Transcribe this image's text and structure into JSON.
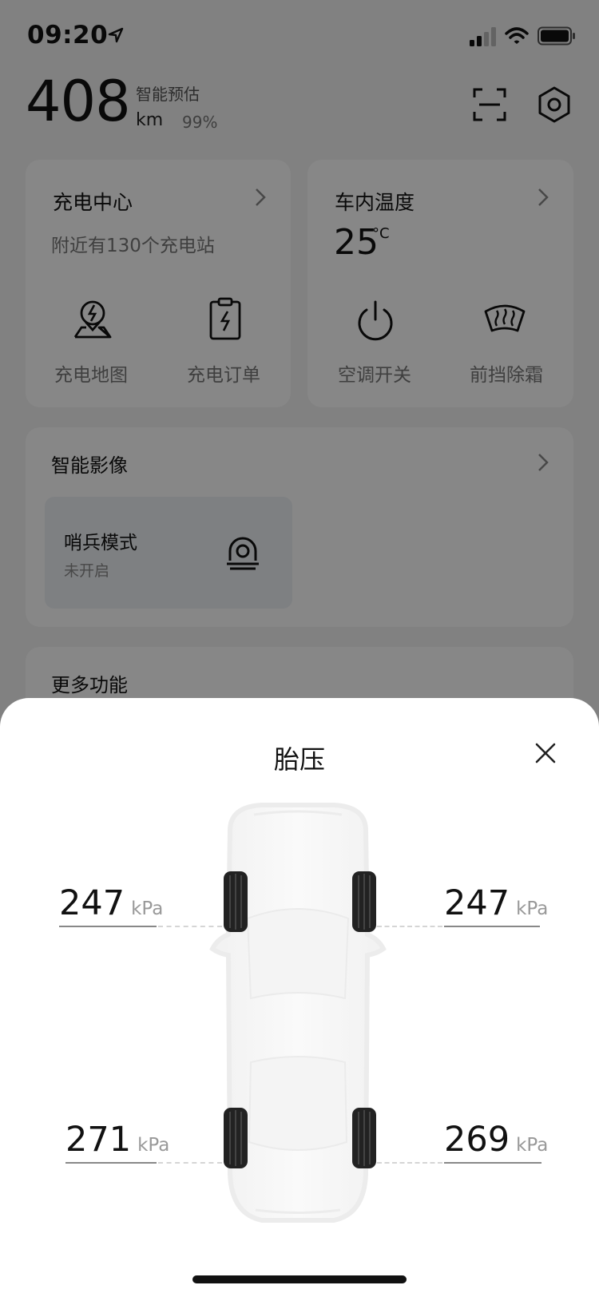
{
  "status_bar": {
    "time": "09:20"
  },
  "header": {
    "range_value": "408",
    "range_label": "智能预估",
    "range_unit": "km",
    "battery_percent": "99%"
  },
  "charging_card": {
    "title": "充电中心",
    "subtitle": "附近有130个充电站",
    "actions": [
      {
        "label": "充电地图",
        "icon": "charging-map-icon"
      },
      {
        "label": "充电订单",
        "icon": "charging-order-icon"
      }
    ]
  },
  "temperature_card": {
    "title": "车内温度",
    "value": "25",
    "unit": "°C",
    "actions": [
      {
        "label": "空调开关",
        "icon": "power-icon"
      },
      {
        "label": "前挡除霜",
        "icon": "windshield-defrost-icon"
      }
    ]
  },
  "video_card": {
    "title": "智能影像",
    "sentry": {
      "title": "哨兵模式",
      "status": "未开启",
      "icon": "sentry-camera-icon"
    }
  },
  "more_card": {
    "title": "更多功能"
  },
  "tire_sheet": {
    "title": "胎压",
    "unit": "kPa",
    "front_left": "247",
    "front_right": "247",
    "rear_left": "271",
    "rear_right": "269"
  },
  "colors": {
    "overlay": "rgba(0,0,0,0.47)",
    "sheet_bg": "#ffffff",
    "text_primary": "#111111",
    "text_secondary": "#999999"
  }
}
